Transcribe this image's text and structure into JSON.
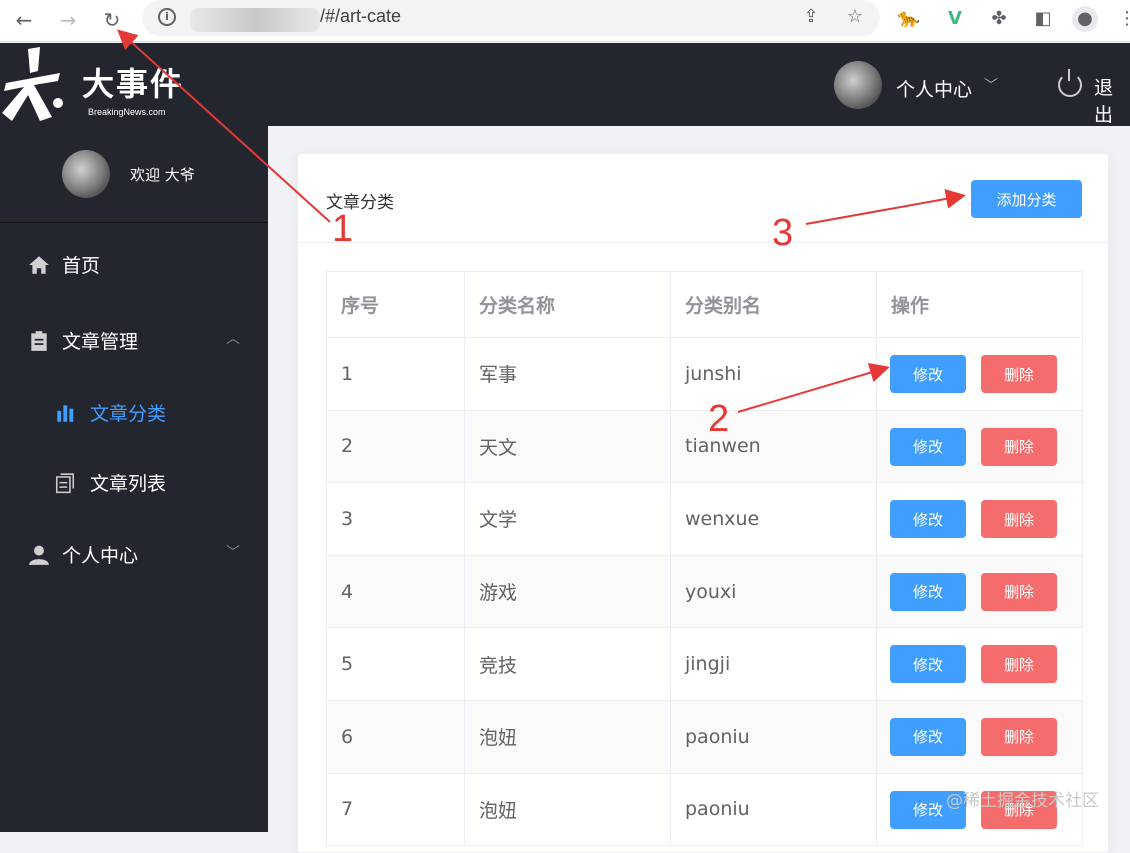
{
  "browser": {
    "url_suffix": "/#/art-cate",
    "info_icon": "info-icon"
  },
  "header": {
    "logo_title": "大事件",
    "logo_sub": "BreakingNews.com",
    "user_menu_label": "个人中心",
    "logout_label": "退出"
  },
  "sidebar": {
    "welcome": "欢迎 大爷",
    "items": [
      {
        "label": "首页",
        "icon": "home-icon"
      },
      {
        "label": "文章管理",
        "icon": "document-icon"
      },
      {
        "label": "文章分类",
        "icon": "bar-chart-icon"
      },
      {
        "label": "文章列表",
        "icon": "list-icon"
      },
      {
        "label": "个人中心",
        "icon": "user-icon"
      }
    ]
  },
  "card": {
    "title": "文章分类",
    "add_button": "添加分类"
  },
  "table": {
    "headers": [
      "序号",
      "分类名称",
      "分类别名",
      "操作"
    ],
    "edit_label": "修改",
    "delete_label": "删除",
    "rows": [
      {
        "index": "1",
        "name": "军事",
        "alias": "junshi"
      },
      {
        "index": "2",
        "name": "天文",
        "alias": "tianwen"
      },
      {
        "index": "3",
        "name": "文学",
        "alias": "wenxue"
      },
      {
        "index": "4",
        "name": "游戏",
        "alias": "youxi"
      },
      {
        "index": "5",
        "name": "竞技",
        "alias": "jingji"
      },
      {
        "index": "6",
        "name": "泡妞",
        "alias": "paoniu"
      },
      {
        "index": "7",
        "name": "泡妞",
        "alias": "paoniu"
      }
    ]
  },
  "annotations": [
    "1",
    "2",
    "3"
  ],
  "watermark": "@稀土掘金技术社区",
  "colors": {
    "primary": "#409eff",
    "danger": "#f56c6c",
    "header_bg": "#23262e",
    "annotation": "#e53935"
  }
}
